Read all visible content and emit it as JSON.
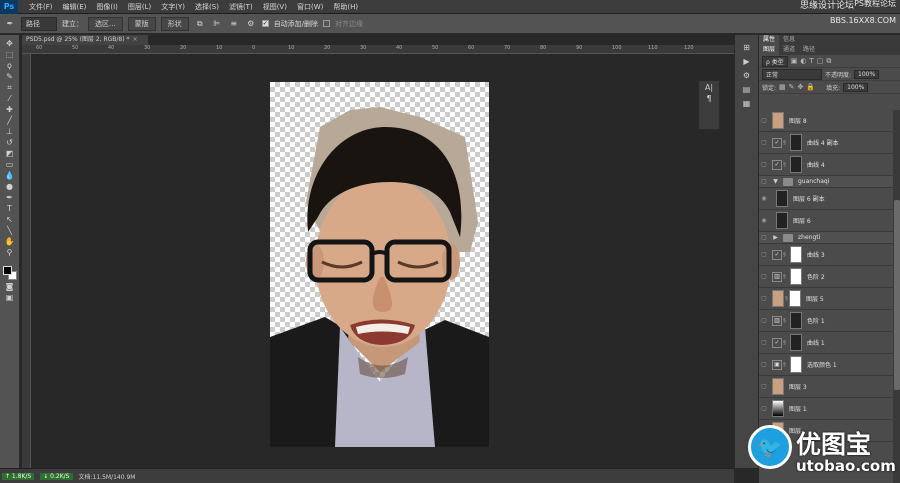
{
  "app": {
    "logo": "Ps"
  },
  "menu": [
    "文件(F)",
    "编辑(E)",
    "图像(I)",
    "图层(L)",
    "文字(Y)",
    "选择(S)",
    "滤镜(T)",
    "视图(V)",
    "窗口(W)",
    "帮助(H)"
  ],
  "watermark_top": {
    "line1": "思缘设计论坛",
    "line2": "PS教程论坛",
    "line3": "BBS.16XX8.COM"
  },
  "options": {
    "mode": "路径",
    "make_label": "建立：",
    "selection_btn": "选区...",
    "mask_btn": "蒙版",
    "shape_btn": "形状",
    "auto_add_delete": "自动添加/删除",
    "auto_add_delete_checked": true,
    "align_edges": "对齐边缘",
    "align_edges_checked": false
  },
  "document": {
    "tab_title": "PSD5.psd @ 25% (图层 2, RGB/8) *",
    "close": "×"
  },
  "ruler": [
    "60",
    "50",
    "40",
    "30",
    "20",
    "10",
    "0",
    "10",
    "20",
    "30",
    "40",
    "50",
    "60",
    "70",
    "80",
    "90",
    "100",
    "110",
    "120"
  ],
  "status": {
    "net_up": "↑ 1.8K/S",
    "net_down": "↓ 0.2K/S",
    "doc_size": "文档:11.5M/140.9M"
  },
  "layers_panel": {
    "tabs_top": [
      "属性",
      "信息"
    ],
    "tabs": [
      "图层",
      "通道",
      "路径"
    ],
    "filter_kind": "ρ 类型",
    "blend_mode": "正常",
    "opacity_label": "不透明度:",
    "opacity_value": "100%",
    "lock_label": "锁定:",
    "fill_label": "填充:",
    "fill_value": "100%",
    "layers": [
      {
        "type": "pixel",
        "thumb": "face",
        "name": "图层 8"
      },
      {
        "type": "adjust",
        "icon": "✓",
        "mask": "black",
        "name": "曲线 4 副本"
      },
      {
        "type": "adjust",
        "icon": "✓",
        "mask": "black",
        "name": "曲线 4"
      },
      {
        "type": "group",
        "name": "guanchaqi",
        "expanded": true
      },
      {
        "type": "pixel",
        "thumb": "black",
        "name": "图层 6 副本"
      },
      {
        "type": "pixel",
        "thumb": "black",
        "name": "图层 6"
      },
      {
        "type": "group",
        "name": "zhengti",
        "expanded": false
      },
      {
        "type": "adjust",
        "icon": "✓",
        "mask": "white",
        "name": "曲线 3"
      },
      {
        "type": "adjust",
        "icon": "▥",
        "mask": "white",
        "name": "色阶 2"
      },
      {
        "type": "pixel",
        "thumb": "face",
        "mask": "white",
        "name": "图层 5"
      },
      {
        "type": "adjust",
        "icon": "▥",
        "mask": "black",
        "name": "色阶 1"
      },
      {
        "type": "adjust",
        "icon": "✓",
        "mask": "black",
        "name": "曲线 1"
      },
      {
        "type": "adjust",
        "icon": "▣",
        "mask": "white",
        "name": "选取颜色 1"
      },
      {
        "type": "pixel",
        "thumb": "face",
        "name": "图层 3"
      },
      {
        "type": "pixel",
        "thumb": "grad",
        "name": "图层 1"
      },
      {
        "type": "pixel",
        "thumb": "face",
        "name": "图层"
      }
    ]
  },
  "logo_watermark": {
    "cn": "优图宝",
    "en": "utobao.com"
  },
  "colors": {
    "foreground": "#000000",
    "background": "#ffffff",
    "accent": "#1ea0e0"
  }
}
